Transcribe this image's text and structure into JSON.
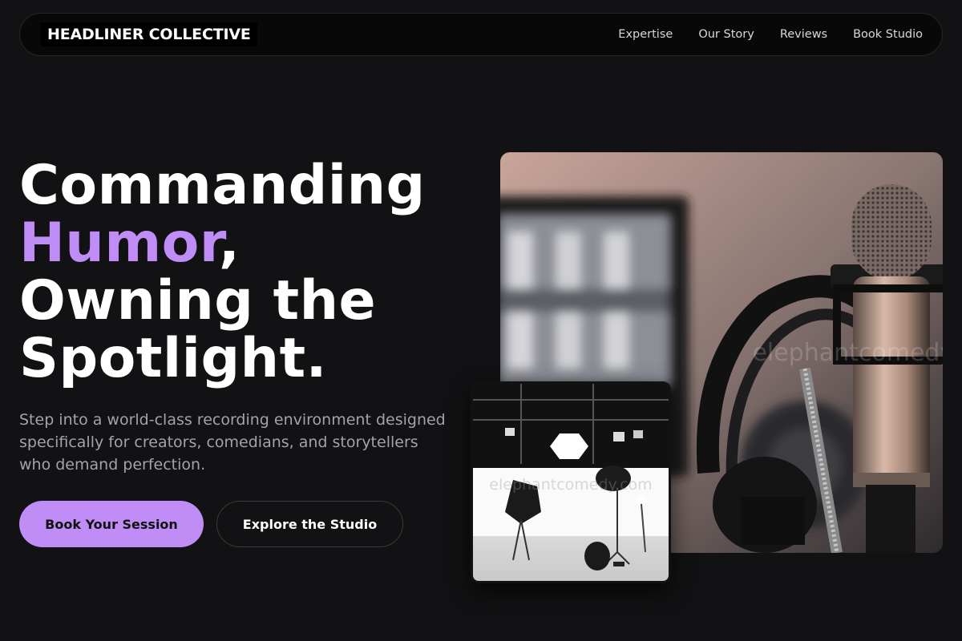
{
  "nav": {
    "brand": "HEADLINER COLLECTIVE",
    "links": [
      {
        "label": "Expertise"
      },
      {
        "label": "Our Story"
      },
      {
        "label": "Reviews"
      },
      {
        "label": "Book Studio"
      }
    ]
  },
  "hero": {
    "line1": "Commanding",
    "accent_word": "Humor",
    "comma": ",",
    "line3": "Owning the",
    "line4": "Spotlight.",
    "subtitle": "Step into a world-class recording environment designed specifically for creators, comedians, and storytellers who demand perfection.",
    "primary_button": "Book Your Session",
    "secondary_button": "Explore the Studio"
  },
  "images": {
    "main_watermark": "elephantcomedy.com",
    "small_watermark": "elephantcomedy.com"
  },
  "colors": {
    "background": "#121113",
    "accent": "#c08cf5",
    "nav_background": "#080808",
    "subtitle_text": "#a3a3a8"
  }
}
